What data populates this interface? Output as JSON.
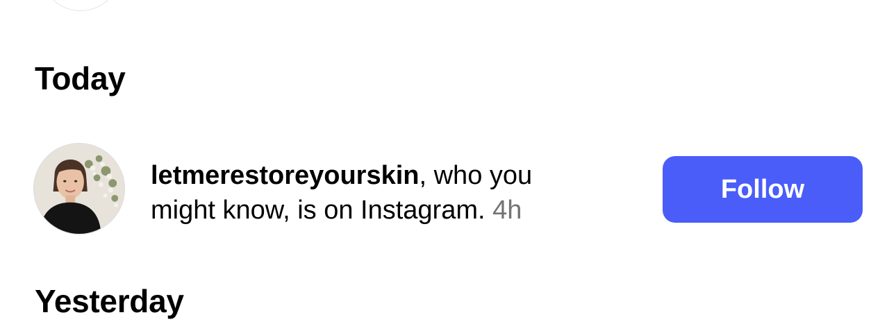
{
  "sections": {
    "today": {
      "heading": "Today"
    },
    "yesterday": {
      "heading": "Yesterday"
    }
  },
  "notification": {
    "username": "letmerestoreyourskin",
    "message": ", who you might know, is on Instagram.",
    "time": "4h",
    "avatar_icon": "profile-photo",
    "follow_label": "Follow"
  },
  "colors": {
    "follow_button": "#4a5df9",
    "follow_text": "#ffffff",
    "timestamp": "#737373",
    "text": "#000000",
    "background": "#ffffff"
  }
}
